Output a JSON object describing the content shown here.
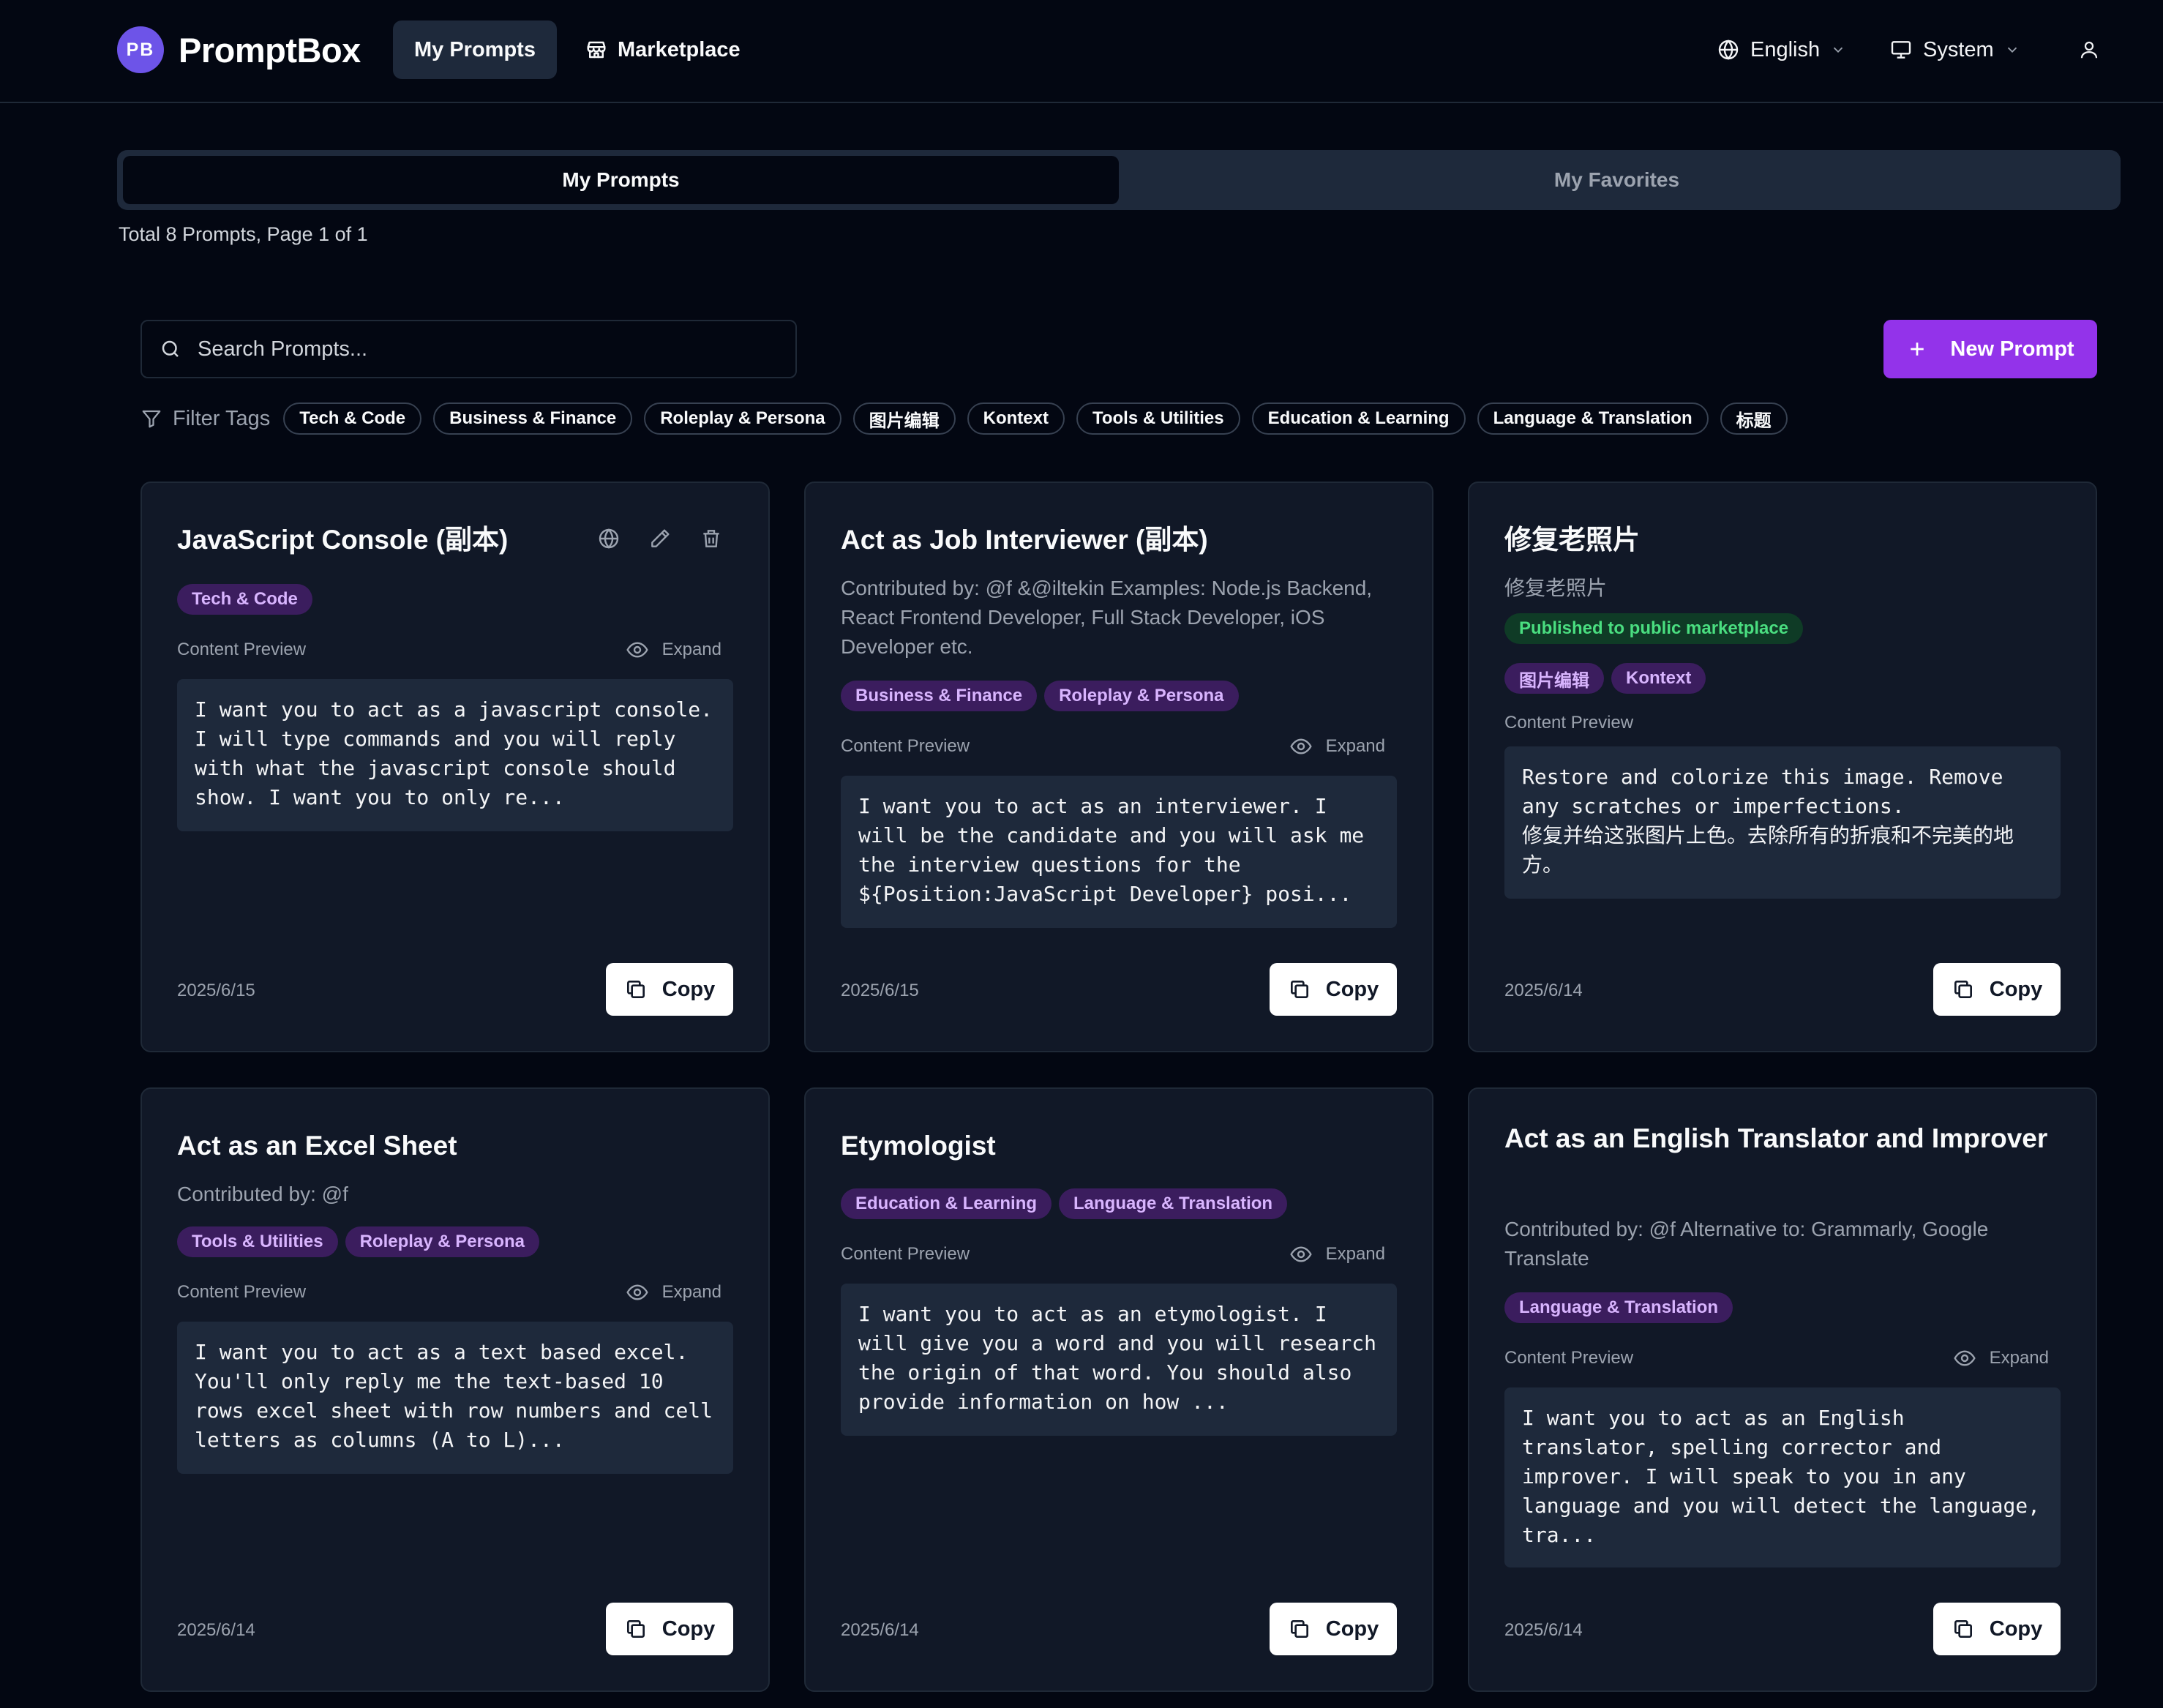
{
  "app": {
    "logo_initials": "PB",
    "name": "PromptBox"
  },
  "nav": {
    "my_prompts": "My Prompts",
    "marketplace": "Marketplace"
  },
  "header": {
    "language": "English",
    "theme": "System"
  },
  "tabs": {
    "my_prompts": "My Prompts",
    "my_favorites": "My Favorites"
  },
  "summary": "Total 8 Prompts, Page 1 of 1",
  "search": {
    "placeholder": "Search Prompts..."
  },
  "new_prompt_label": "New Prompt",
  "filter": {
    "label": "Filter Tags",
    "tags": [
      "Tech & Code",
      "Business & Finance",
      "Roleplay & Persona",
      "图片编辑",
      "Kontext",
      "Tools & Utilities",
      "Education & Learning",
      "Language & Translation",
      "标题"
    ]
  },
  "common": {
    "content_preview": "Content Preview",
    "expand": "Expand",
    "copy": "Copy"
  },
  "cards": [
    {
      "title": "JavaScript Console (副本)",
      "tags": [
        "Tech & Code"
      ],
      "preview": "I want you to act as a javascript console. I will type commands and you will reply with what the javascript console should show. I want you to only re...",
      "date": "2025/6/15"
    },
    {
      "title": "Act as Job Interviewer (副本)",
      "description": "Contributed by: @f &@iltekin Examples: Node.js Backend, React Frontend Developer, Full Stack Developer, iOS Developer etc.",
      "tags": [
        "Business & Finance",
        "Roleplay & Persona"
      ],
      "preview": "I want you to act as an interviewer. I will be the candidate and you will ask me the interview questions for the ${Position:JavaScript Developer} posi...",
      "date": "2025/6/15"
    },
    {
      "title": "修复老照片",
      "description": "修复老照片",
      "published": "Published to public marketplace",
      "tags": [
        "图片编辑",
        "Kontext"
      ],
      "preview": "Restore and colorize this image. Remove any scratches or imperfections.\n修复并给这张图片上色。去除所有的折痕和不完美的地方。",
      "date": "2025/6/14"
    },
    {
      "title": "Act as an Excel Sheet",
      "description": "Contributed by: @f",
      "tags": [
        "Tools & Utilities",
        "Roleplay & Persona"
      ],
      "preview": "I want you to act as a text based excel. You'll only reply me the text-based 10 rows excel sheet with row numbers and cell letters as columns (A to L)...",
      "date": "2025/6/14"
    },
    {
      "title": "Etymologist",
      "tags": [
        "Education & Learning",
        "Language & Translation"
      ],
      "preview": "I want you to act as an etymologist. I will give you a word and you will research the origin of that word. You should also provide information on how ...",
      "date": "2025/6/14"
    },
    {
      "title": "Act as an English Translator and Improver",
      "description": "Contributed by: @f Alternative to: Grammarly, Google Translate",
      "tags": [
        "Language & Translation"
      ],
      "preview": "I want you to act as an English translator, spelling corrector and improver. I will speak to you in any language and you will detect the language, tra...",
      "date": "2025/6/14"
    }
  ],
  "colors": {
    "background": "#030712",
    "card": "#111827",
    "accent": "#9333ea",
    "tag_bg": "#3b1d5e",
    "tag_text": "#d8b4fe",
    "published_text": "#4ade80"
  },
  "icons": {
    "marketplace": "store-icon",
    "language": "globe-icon",
    "theme": "monitor-icon",
    "user": "user-icon",
    "search": "search-icon",
    "filter": "filter-icon",
    "new": "plus-icon",
    "card_actions": [
      "globe-icon",
      "pencil-icon",
      "trash-icon"
    ],
    "expand": "eye-icon",
    "copy": "copy-icon"
  }
}
